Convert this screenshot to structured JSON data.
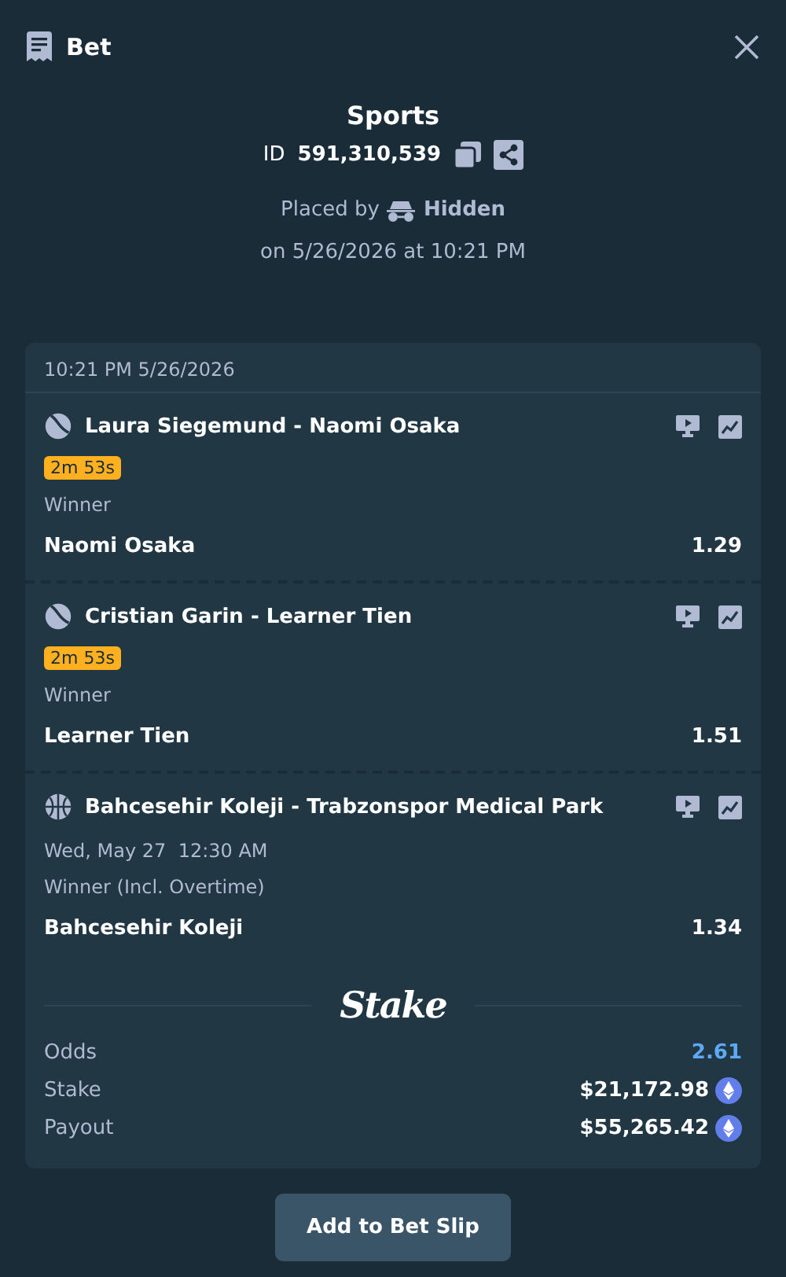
{
  "header": {
    "title": "Bet"
  },
  "summary": {
    "category": "Sports",
    "id_label": "ID",
    "id_value": "591,310,539",
    "placed_by_label": "Placed by",
    "placed_by_user": "Hidden",
    "placed_on": "on 5/26/2026 at 10:21 PM"
  },
  "slip": {
    "timestamp": "10:21 PM 5/26/2026",
    "legs": [
      {
        "kind": "tennis",
        "event": "Laura Siegemund - Naomi Osaka",
        "timer": "2m 53s",
        "market": "Winner",
        "selection": "Naomi Osaka",
        "odds": "1.29"
      },
      {
        "kind": "tennis",
        "event": "Cristian Garin - Learner Tien",
        "timer": "2m 53s",
        "market": "Winner",
        "selection": "Learner Tien",
        "odds": "1.51"
      },
      {
        "kind": "basketball",
        "event": "Bahcesehir Koleji - Trabzonspor Medical Park",
        "start_time": "Wed, May 27  12:30 AM",
        "market": "Winner (Incl. Overtime)",
        "selection": "Bahcesehir Koleji",
        "odds": "1.34"
      }
    ],
    "logo": "Stake",
    "totals": [
      {
        "kind": "odds",
        "label": "Odds",
        "value": "2.61"
      },
      {
        "kind": "amount",
        "label": "Stake",
        "value": "$21,172.98"
      },
      {
        "kind": "amount",
        "label": "Payout",
        "value": "$55,265.42"
      }
    ]
  },
  "button": "Add to Bet Slip"
}
